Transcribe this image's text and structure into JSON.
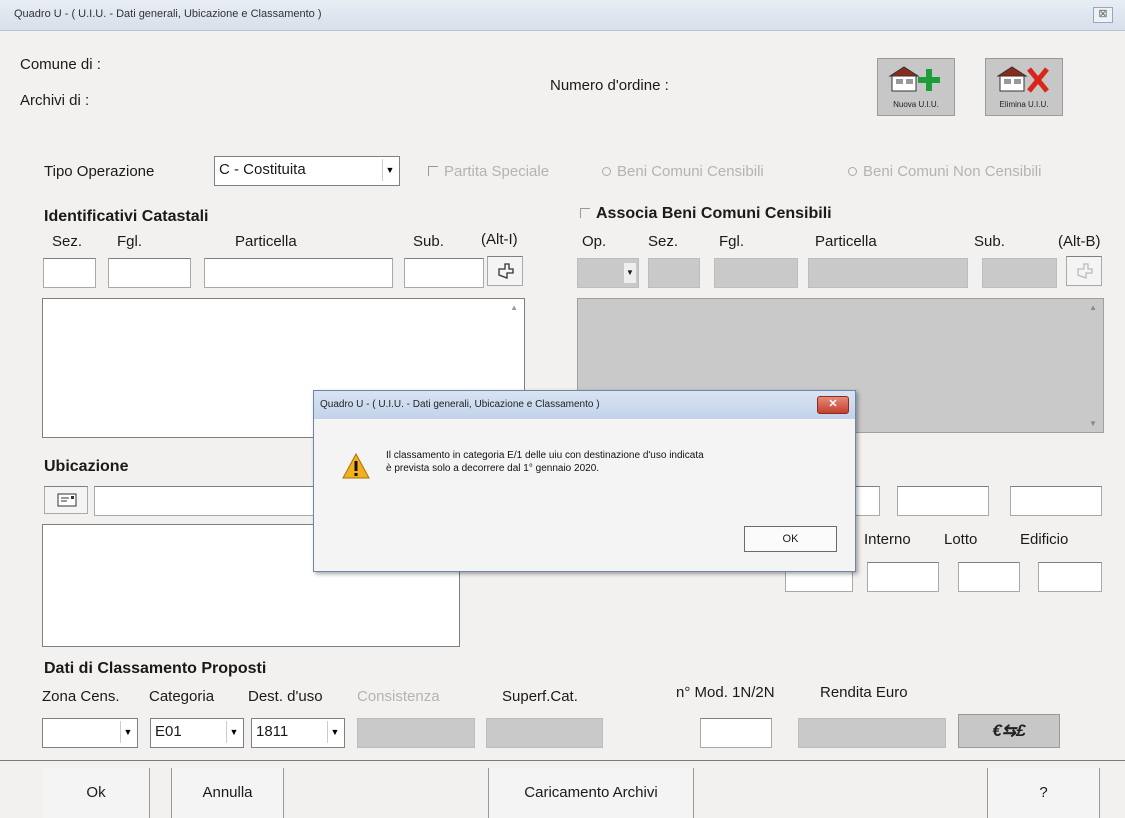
{
  "window": {
    "title": "Quadro U - ( U.I.U. - Dati generali, Ubicazione e Classamento )",
    "close": "⊠"
  },
  "header": {
    "comune_label": "Comune di  :",
    "archivi_label": "Archivi di   :",
    "numero_ordine_label": "Numero d'ordine :",
    "nuova_uiu": "Nuova U.I.U.",
    "elimina_uiu": "Elimina U.I.U."
  },
  "tipo": {
    "label": "Tipo Operazione",
    "value": "C - Costituita",
    "partita_speciale": "Partita Speciale",
    "beni_comuni_censibili": "Beni Comuni Censibili",
    "beni_comuni_non_censibili": "Beni Comuni Non Censibili"
  },
  "identificativi": {
    "title": "Identificativi Catastali",
    "sez": "Sez.",
    "fgl": "Fgl.",
    "particella": "Particella",
    "sub": "Sub.",
    "shortcut": "(Alt-I)"
  },
  "associa": {
    "title": "Associa Beni Comuni Censibili",
    "op": "Op.",
    "sez": "Sez.",
    "fgl": "Fgl.",
    "particella": "Particella",
    "sub": "Sub.",
    "shortcut": "(Alt-B)"
  },
  "ubicazione": {
    "title": "Ubicazione",
    "interno": "Interno",
    "lotto": "Lotto",
    "edificio": "Edificio"
  },
  "classamento": {
    "title": "Dati di Classamento Proposti",
    "zona": "Zona Cens.",
    "categoria": "Categoria",
    "categoria_value": "E01",
    "dest_uso": "Dest. d'uso",
    "dest_uso_value": "1811",
    "consistenza": "Consistenza",
    "superf": "Superf.Cat.",
    "mod": "n° Mod. 1N/2N",
    "rendita": "Rendita  Euro",
    "currency_btn": "€⇆£"
  },
  "footer": {
    "ok": "Ok",
    "annulla": "Annulla",
    "caricamento": "Caricamento Archivi",
    "help": "?"
  },
  "dialog": {
    "title": "Quadro U - ( U.I.U. - Dati generali, Ubicazione e Classamento )",
    "close": "✕",
    "line1": "Il classamento in categoria E/1 delle uiu con destinazione d'uso indicata",
    "line2": "è prevista solo a decorrere dal 1° gennaio 2020.",
    "ok": "OK"
  }
}
